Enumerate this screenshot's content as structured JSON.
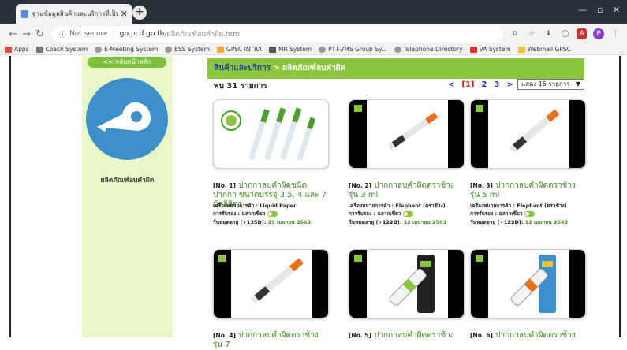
{
  "browser": {
    "tab_title": "ฐานข้อมูลสินค้าและบริการที่เป็นมิตรกับ",
    "address_secure": "Not secure",
    "address_domain": "gp.pcd.go.th",
    "address_path": "/ผลิตภัณฑ์ลบคำผิด.htm",
    "bookmarks": [
      {
        "label": "Apps",
        "color": "#e24a3b"
      },
      {
        "label": "Coach System",
        "color": "#777777"
      },
      {
        "label": "E-Meeting System",
        "color": "#888888"
      },
      {
        "label": "ESS System",
        "color": "#888888"
      },
      {
        "label": "GPSC INTRA",
        "color": "#f2a530"
      },
      {
        "label": "MR System",
        "color": "#555555"
      },
      {
        "label": "PTT-VMS Group Sy...",
        "color": "#888888"
      },
      {
        "label": "Telephone Directory",
        "color": "#888888"
      },
      {
        "label": "VA System",
        "color": "#d33"
      },
      {
        "label": "Webmail GPSC",
        "color": "#f2c230"
      }
    ]
  },
  "sidebar": {
    "back_label": "<< กลับหน้าหลัก",
    "category_title": "ผลิตภัณฑ์ลบคำผิด"
  },
  "content": {
    "crumb_parent": "สินค้าและบริการ",
    "crumb_sep": " > ",
    "crumb_current": "ผลิตภัณฑ์ลบคำผิด",
    "found_text": "พบ 31 รายการ",
    "pager": {
      "prev": "<",
      "current": "[1]",
      "p2": "2",
      "p3": "3",
      "next": ">"
    },
    "per_page": "แสดง 15 รายการ",
    "per_page_arrow": "▼"
  },
  "products": [
    {
      "no": "[No. 1]",
      "name": "ปากกาลบคำผิดชนิดปากกา ขนาดบรรจุ 3.5, 4 และ 7 มิลลิลิตร",
      "brand_label": "เครื่องหมายการค้า : ",
      "brand": "Liquid Paper",
      "cert": "การรับรอง : ฉลากเขียว",
      "expiry_label": "วันหมดอายุ (+135D): ",
      "expiry": "29 เมษายน 2563"
    },
    {
      "no": "[No. 2]",
      "name": "ปากกาลบคำผิดตราช้าง รุ่น 3 ml",
      "brand_label": "เครื่องหมายการค้า : ",
      "brand": "Elephant (ตราช้าง)",
      "cert": "การรับรอง : ฉลากเขียว",
      "expiry_label": "วันหมดอายุ (+122D): ",
      "expiry": "12 เมษายน 2563"
    },
    {
      "no": "[No. 3]",
      "name": "ปากกาลบคำผิดตราช้าง รุ่น 5 ml",
      "brand_label": "เครื่องหมายการค้า : ",
      "brand": "Elephant (ตราช้าง)",
      "cert": "การรับรอง : ฉลากเขียว",
      "expiry_label": "วันหมดอายุ (+122D): ",
      "expiry": "12 เมษายน 2563"
    },
    {
      "no": "[No. 4]",
      "name": "ปากกาลบคำผิดตราช้าง รุ่น 7"
    },
    {
      "no": "[No. 5]",
      "name": "ปากกาลบคำผิดตราช้าง"
    },
    {
      "no": "[No. 6]",
      "name": "ปากกาลบคำผิดตราช้าง"
    }
  ]
}
